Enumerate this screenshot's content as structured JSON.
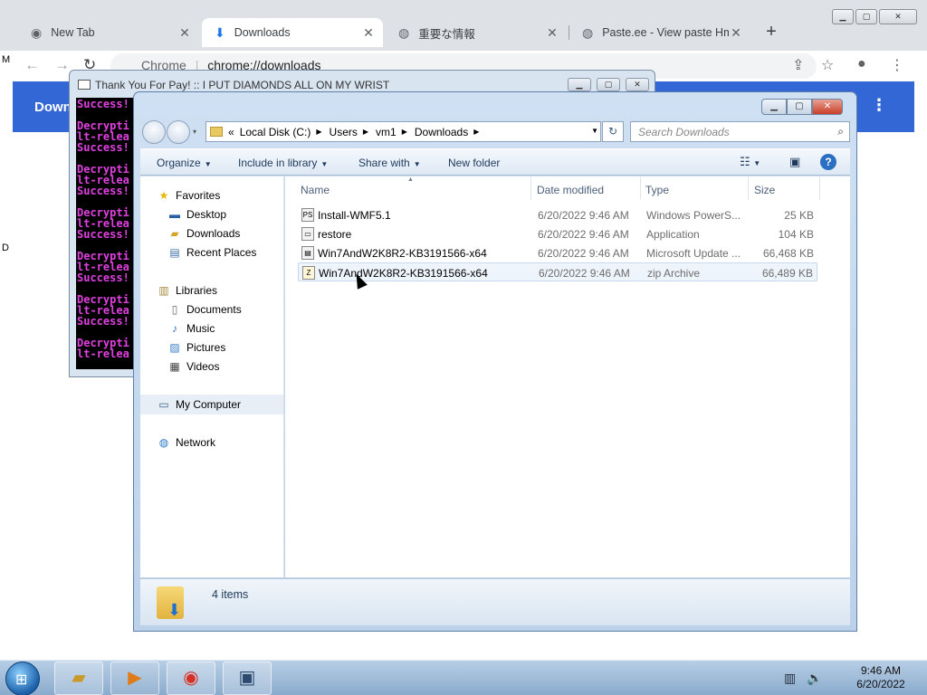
{
  "browser": {
    "tabs": [
      {
        "title": "New Tab",
        "icon": "chrome-icon",
        "active": false
      },
      {
        "title": "Downloads",
        "icon": "download-icon",
        "active": true
      },
      {
        "title": "重要な情報",
        "icon": "globe-icon",
        "active": false
      },
      {
        "title": "Paste.ee - View paste Hm",
        "icon": "globe-icon",
        "active": false
      }
    ],
    "omnibox_site": "Chrome",
    "omnibox_url": "chrome://downloads",
    "page_title": "Down",
    "side_letters": [
      "M",
      "D"
    ]
  },
  "console": {
    "title": "Thank You For Pay! :: I PUT DIAMONDS ALL ON MY WRIST",
    "lines": [
      "Success!",
      "",
      "Decrypti",
      "lt-relea",
      "Success!",
      "",
      "Decrypti",
      "lt-relea",
      "Success!",
      "",
      "Decrypti",
      "lt-relea",
      "Success!",
      "",
      "Decrypti",
      "lt-relea",
      "Success!",
      "",
      "Decrypti",
      "lt-relea",
      "Success!",
      "",
      "Decrypti",
      "lt-relea"
    ]
  },
  "explorer": {
    "breadcrumb_prefix": "«",
    "breadcrumbs": [
      "Local Disk (C:)",
      "Users",
      "vm1",
      "Downloads"
    ],
    "search_placeholder": "Search Downloads",
    "commands": [
      "Organize",
      "Include in library",
      "Share with",
      "New folder"
    ],
    "nav": {
      "favorites_label": "Favorites",
      "favorites": [
        "Desktop",
        "Downloads",
        "Recent Places"
      ],
      "libraries_label": "Libraries",
      "libraries": [
        "Documents",
        "Music",
        "Pictures",
        "Videos"
      ],
      "computer_label": "My Computer",
      "network_label": "Network"
    },
    "columns": [
      "Name",
      "Date modified",
      "Type",
      "Size"
    ],
    "files": [
      {
        "name": "Install-WMF5.1",
        "date": "6/20/2022 9:46 AM",
        "type": "Windows PowerS...",
        "size": "25 KB"
      },
      {
        "name": "restore",
        "date": "6/20/2022 9:46 AM",
        "type": "Application",
        "size": "104 KB"
      },
      {
        "name": "Win7AndW2K8R2-KB3191566-x64",
        "date": "6/20/2022 9:46 AM",
        "type": "Microsoft Update ...",
        "size": "66,468 KB"
      },
      {
        "name": "Win7AndW2K8R2-KB3191566-x64",
        "date": "6/20/2022 9:46 AM",
        "type": "zip Archive",
        "size": "66,489 KB"
      }
    ],
    "item_count": "4 items"
  },
  "taskbar": {
    "time": "9:46 AM",
    "date": "6/20/2022"
  }
}
